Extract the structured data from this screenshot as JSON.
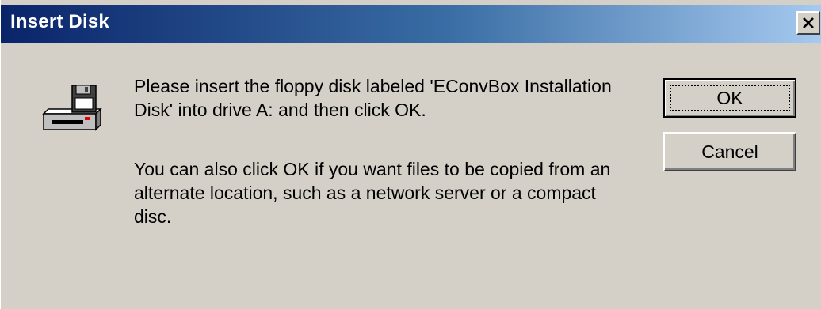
{
  "dialog": {
    "title": "Insert Disk",
    "close_label": "×",
    "icon": "floppy-drive-icon",
    "message_primary": "Please insert the floppy disk labeled 'EConvBox Installation Disk' into drive A: and then click OK.",
    "message_secondary": "You can also click OK if you want files to be copied from an alternate location, such as a network server or a compact disc."
  },
  "buttons": {
    "ok_label": "OK",
    "cancel_label": "Cancel"
  },
  "colors": {
    "face": "#d4d0c8",
    "title_start": "#0a246a",
    "title_end": "#a6caf0",
    "title_text": "#ffffff"
  }
}
